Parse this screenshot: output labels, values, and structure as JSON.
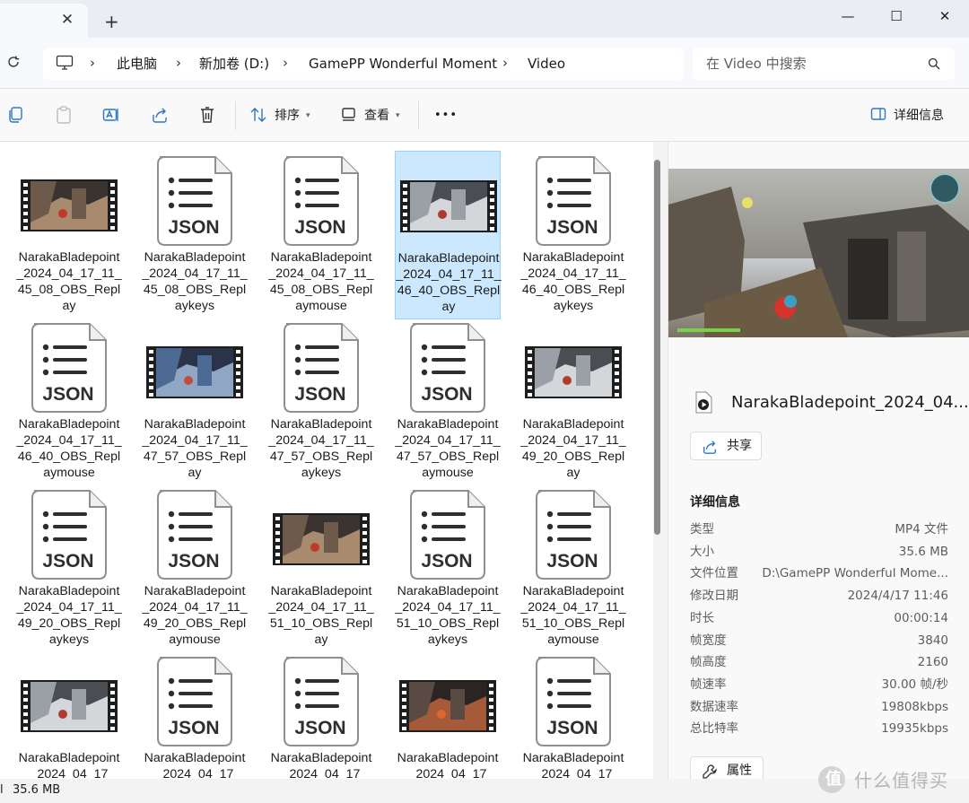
{
  "window": {
    "new_tab": "+",
    "close_tab": "✕",
    "minimize": "—",
    "maximize": "☐",
    "close": "✕"
  },
  "breadcrumbs": [
    "此电脑",
    "新加卷 (D:)",
    "GamePP Wonderful Moment",
    "Video"
  ],
  "search": {
    "placeholder": "在 Video 中搜索"
  },
  "toolbar": {
    "sort_label": "排序",
    "view_label": "查看",
    "more_label": "•••",
    "details_label": "详细信息"
  },
  "files": [
    {
      "type": "video",
      "thumb": "dark",
      "name": "NarakaBladepoint_2024_04_17_11_45_08_OBS_Replay"
    },
    {
      "type": "json",
      "name": "NarakaBladepoint_2024_04_17_11_45_08_OBS_Replaykeys"
    },
    {
      "type": "json",
      "name": "NarakaBladepoint_2024_04_17_11_45_08_OBS_Replaymouse"
    },
    {
      "type": "video",
      "thumb": "snow",
      "selected": true,
      "name": "NarakaBladepoint_2024_04_17_11_46_40_OBS_Replay"
    },
    {
      "type": "json",
      "name": "NarakaBladepoint_2024_04_17_11_46_40_OBS_Replaykeys"
    },
    {
      "type": "json",
      "name": "NarakaBladepoint_2024_04_17_11_46_40_OBS_Replaymouse"
    },
    {
      "type": "video",
      "thumb": "blue",
      "name": "NarakaBladepoint_2024_04_17_11_47_57_OBS_Replay"
    },
    {
      "type": "json",
      "name": "NarakaBladepoint_2024_04_17_11_47_57_OBS_Replaykeys"
    },
    {
      "type": "json",
      "name": "NarakaBladepoint_2024_04_17_11_47_57_OBS_Replaymouse"
    },
    {
      "type": "video",
      "thumb": "snow",
      "name": "NarakaBladepoint_2024_04_17_11_49_20_OBS_Replay"
    },
    {
      "type": "json",
      "name": "NarakaBladepoint_2024_04_17_11_49_20_OBS_Replaykeys"
    },
    {
      "type": "json",
      "name": "NarakaBladepoint_2024_04_17_11_49_20_OBS_Replaymouse"
    },
    {
      "type": "video",
      "thumb": "dark",
      "name": "NarakaBladepoint_2024_04_17_11_51_10_OBS_Replay"
    },
    {
      "type": "json",
      "name": "NarakaBladepoint_2024_04_17_11_51_10_OBS_Replaykeys"
    },
    {
      "type": "json",
      "name": "NarakaBladepoint_2024_04_17_11_51_10_OBS_Replaymouse"
    },
    {
      "type": "video",
      "thumb": "snow",
      "name": "NarakaBladepoint_2024_04_17"
    },
    {
      "type": "json",
      "name": "NarakaBladepoint_2024_04_17"
    },
    {
      "type": "json",
      "name": "NarakaBladepoint_2024_04_17"
    },
    {
      "type": "video",
      "thumb": "fire",
      "name": "NarakaBladepoint_2024_04_17"
    },
    {
      "type": "json",
      "name": "NarakaBladepoint_2024_04_17"
    }
  ],
  "json_icon_label": "JSON",
  "details": {
    "title": "NarakaBladepoint_2024_04...",
    "share_label": "共享",
    "section_title": "详细信息",
    "rows": [
      {
        "key": "类型",
        "value": "MP4 文件"
      },
      {
        "key": "大小",
        "value": "35.6 MB"
      },
      {
        "key": "文件位置",
        "value": "D:\\GamePP Wonderful Mome..."
      },
      {
        "key": "修改日期",
        "value": "2024/4/17 11:46"
      },
      {
        "key": "时长",
        "value": "00:00:14"
      },
      {
        "key": "帧宽度",
        "value": "3840"
      },
      {
        "key": "帧高度",
        "value": "2160"
      },
      {
        "key": "帧速率",
        "value": "30.00 帧/秒"
      },
      {
        "key": "数据速率",
        "value": "19808kbps"
      },
      {
        "key": "总比特率",
        "value": "19935kbps"
      }
    ],
    "properties_label": "属性"
  },
  "status": {
    "selection_size": "35.6 MB",
    "edge_glyph": "l"
  },
  "watermark": {
    "logo_glyph": "值",
    "text": "什么值得买"
  },
  "colors": {
    "selection_bg": "#cce8ff",
    "selection_border": "#99d1ff",
    "accent": "#0067c0"
  }
}
